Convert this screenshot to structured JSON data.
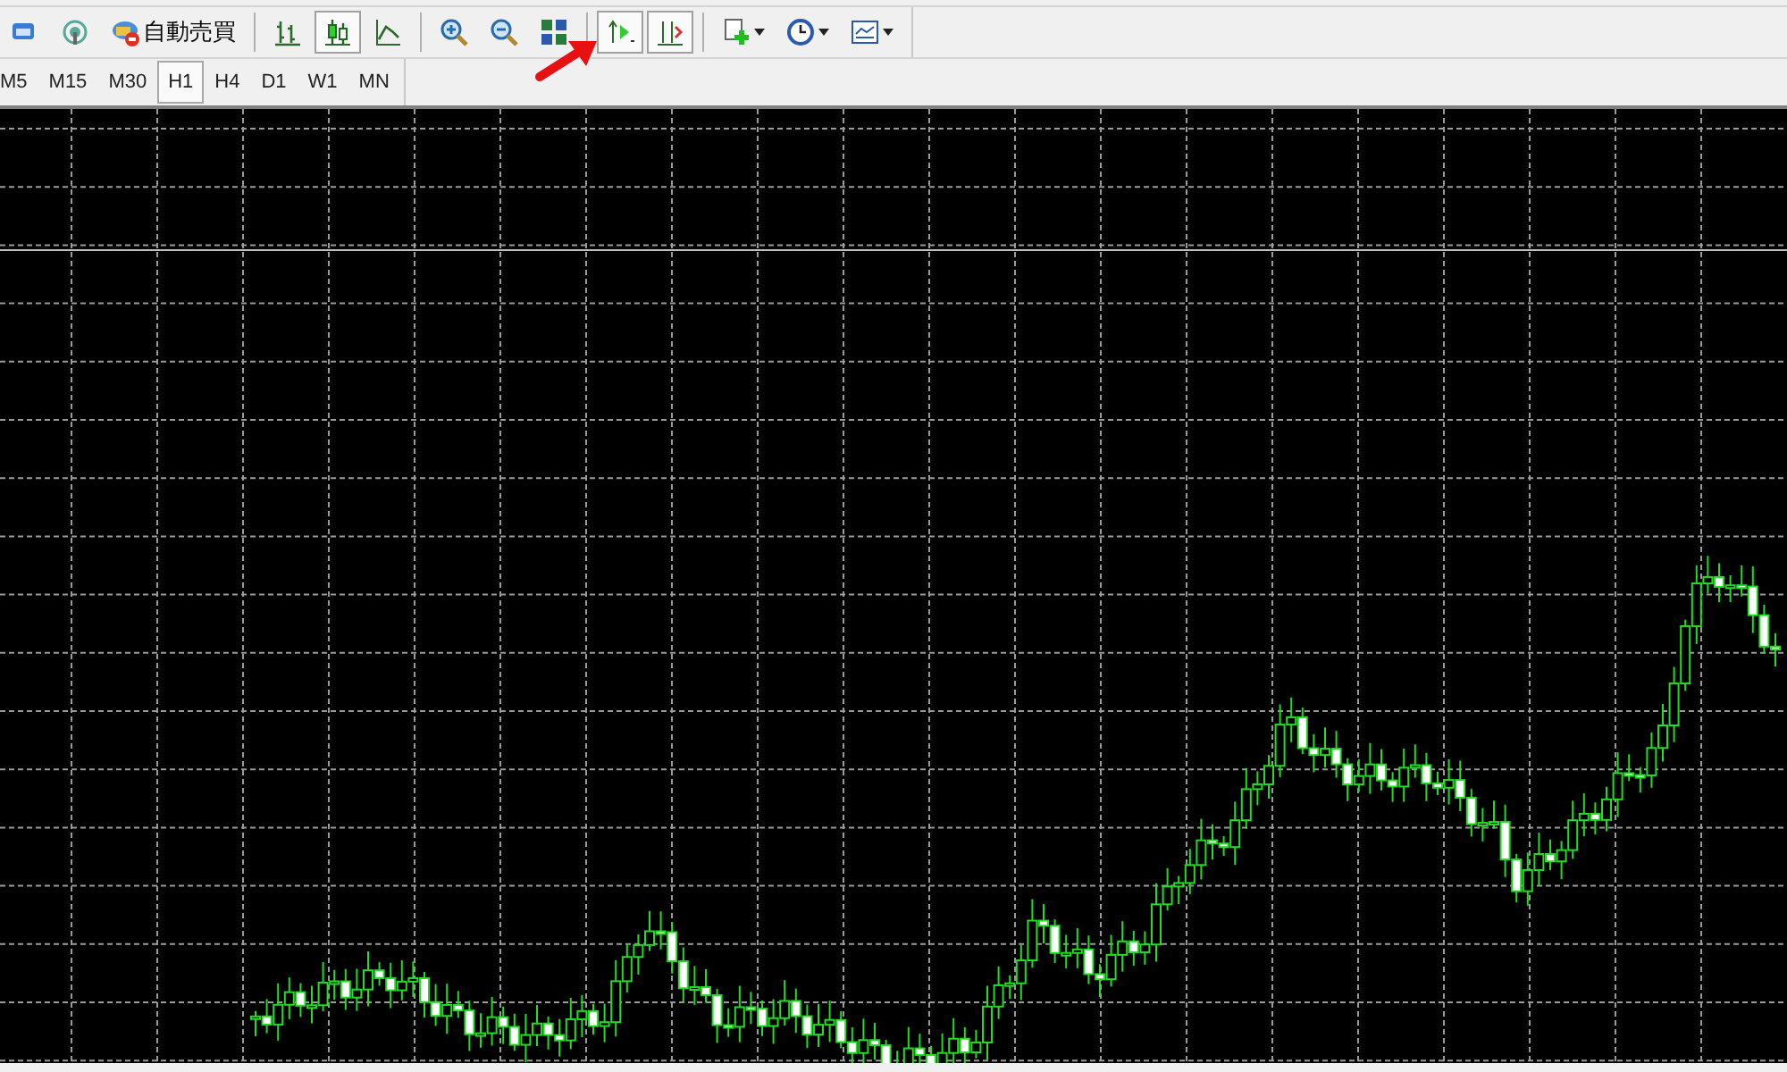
{
  "toolbar": {
    "items": [
      {
        "kind": "profiles",
        "selected": false
      },
      {
        "kind": "signal",
        "selected": false
      },
      {
        "kind": "auto_trading",
        "label": "自動売買",
        "selected": false
      },
      {
        "kind": "separator"
      },
      {
        "kind": "bar_chart",
        "selected": false
      },
      {
        "kind": "candles",
        "selected": true
      },
      {
        "kind": "line_chart",
        "selected": false
      },
      {
        "kind": "separator"
      },
      {
        "kind": "zoom_in",
        "selected": false
      },
      {
        "kind": "zoom_out",
        "selected": false
      },
      {
        "kind": "tile",
        "selected": false
      },
      {
        "kind": "separator"
      },
      {
        "kind": "chart_shift",
        "selected": true
      },
      {
        "kind": "auto_scroll",
        "selected": true
      },
      {
        "kind": "separator"
      },
      {
        "kind": "indicators",
        "selected": false,
        "dropdown": true
      },
      {
        "kind": "periods",
        "selected": false,
        "dropdown": true
      },
      {
        "kind": "templates",
        "selected": false,
        "dropdown": true
      }
    ]
  },
  "timeframes": [
    {
      "label": "M5",
      "selected": false
    },
    {
      "label": "M15",
      "selected": false
    },
    {
      "label": "M30",
      "selected": false
    },
    {
      "label": "H1",
      "selected": true
    },
    {
      "label": "H4",
      "selected": false
    },
    {
      "label": "D1",
      "selected": false
    },
    {
      "label": "W1",
      "selected": false
    },
    {
      "label": "MN",
      "selected": false
    }
  ]
}
